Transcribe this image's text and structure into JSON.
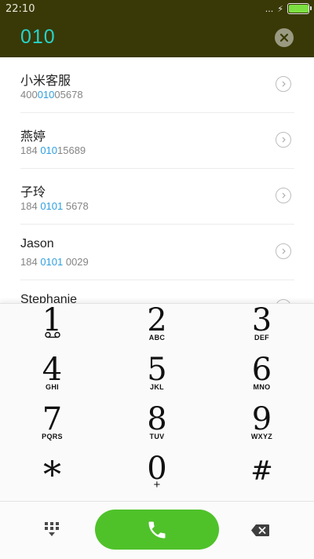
{
  "status_bar": {
    "time": "22:10",
    "overflow": "...",
    "battery_level": 0.95,
    "battery_color": "#7be040"
  },
  "dialer": {
    "number": "010",
    "number_color": "#27d3c8",
    "clear_icon": "close-circle-icon"
  },
  "contacts": [
    {
      "name": "小米客服",
      "number_before": "400",
      "number_match": "010",
      "number_after": "05678"
    },
    {
      "name": "燕婷",
      "number_before": "184 ",
      "number_match": "010",
      "number_after": "15689"
    },
    {
      "name": "子玲",
      "number_before": "184 ",
      "number_match": "0101",
      "number_after": " 5678"
    },
    {
      "name": "Jason",
      "number_before": "184 ",
      "number_match": "0101",
      "number_after": " 0029"
    },
    {
      "name": "Stephanie",
      "number_before": "",
      "number_match": "",
      "number_after": ""
    }
  ],
  "highlight_color": "#2f9fe0",
  "keypad": [
    {
      "digit": "1",
      "letters": ""
    },
    {
      "digit": "2",
      "letters": "ABC"
    },
    {
      "digit": "3",
      "letters": "DEF"
    },
    {
      "digit": "4",
      "letters": "GHI"
    },
    {
      "digit": "5",
      "letters": "JKL"
    },
    {
      "digit": "6",
      "letters": "MNO"
    },
    {
      "digit": "7",
      "letters": "PQRS"
    },
    {
      "digit": "8",
      "letters": "TUV"
    },
    {
      "digit": "9",
      "letters": "WXYZ"
    },
    {
      "digit": "*",
      "letters": ""
    },
    {
      "digit": "0",
      "letters": "+"
    },
    {
      "digit": "#",
      "letters": ""
    }
  ],
  "actions": {
    "keypad_toggle_icon": "dialpad-icon",
    "call_icon": "phone-icon",
    "call_color": "#4fc22a",
    "backspace_icon": "backspace-icon"
  }
}
